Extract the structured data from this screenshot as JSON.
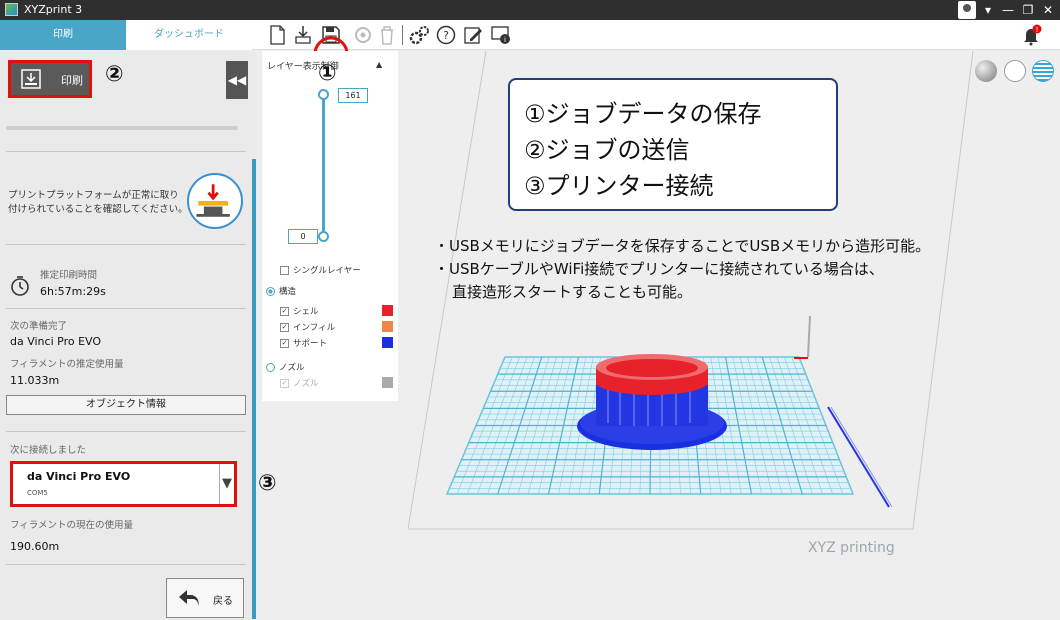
{
  "window": {
    "title": "XYZprint 3"
  },
  "tabs": {
    "print": "印刷",
    "dashboard": "ダッシュボード"
  },
  "left": {
    "print_button": "印刷",
    "collapse": "◀◀",
    "notice": "プリントプラットフォームが正常に取り付けられていることを確認してください。",
    "est_time_label": "推定印刷時間",
    "est_time_value": "6h:57m:29s",
    "ready_label": "次の準備完了",
    "ready_value": "da Vinci Pro EVO",
    "filament_est_label": "フィラメントの推定使用量",
    "filament_est_value": "11.033m",
    "object_info_button": "オブジェクト情報",
    "connected_label": "次に接続しました",
    "printer_name": "da Vinci Pro EVO",
    "printer_port": "COM5",
    "filament_now_label": "フィラメントの現在の使用量",
    "filament_now_value": "190.60m",
    "back_button": "戻る"
  },
  "layer": {
    "title": "レイヤー表示制御",
    "top_value": "161",
    "bottom_value": "0",
    "single_layer": "シングルレイヤー",
    "structure": "構造",
    "shell": "シェル",
    "infill": "インフィル",
    "support": "サポート",
    "nozzle": "ノズル",
    "nozzle_sub": "ノズル"
  },
  "annotations": {
    "n1": "①",
    "n2": "②",
    "n3": "③",
    "callout1": "①ジョブデータの保存",
    "callout2": "②ジョブの送信",
    "callout3": "③プリンター接続",
    "note1": "・USBメモリにジョブデータを保存することでUSBメモリから造形可能。",
    "note2": "・USBケーブルやWiFi接続でプリンターに接続されている場合は、",
    "note3": "直接造形スタートすることも可能。"
  },
  "brand": "XYZ printing",
  "colors": {
    "accent": "#4aa6c6",
    "shell": "#e8222a",
    "infill": "#f0874a",
    "support": "#1a2fe0",
    "nozzle": "#aaaaaa",
    "highlight": "#e01010"
  },
  "icons": [
    "new-file-icon",
    "import-icon",
    "save-icon",
    "settings-icon",
    "delete-icon",
    "gear-icon",
    "help-icon",
    "edit-icon",
    "info-icon",
    "bell-icon"
  ]
}
